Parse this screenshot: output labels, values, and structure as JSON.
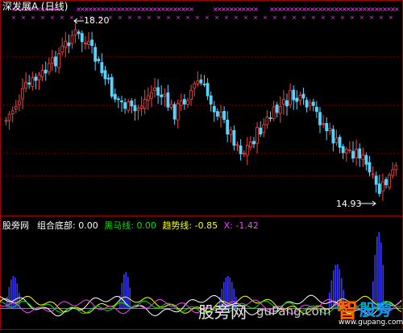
{
  "window": {
    "title": "深发展A (日线)"
  },
  "price_chart": {
    "high_label": "18.20",
    "low_label": "14.93",
    "colors": {
      "up": "#ff4040",
      "down": "#54d4ff",
      "marker": "#ff40ff",
      "frame": "#a00000",
      "text": "#c8c8c8"
    }
  },
  "indicator_legend": {
    "source": "股旁网",
    "items": [
      {
        "label": "组合底部:",
        "value": "0.00",
        "color": "#ffffff"
      },
      {
        "label": "黑马线:",
        "value": "0.00",
        "color": "#00e000"
      },
      {
        "label": "趋势线:",
        "value": "-0.85",
        "color": "#ffff00"
      },
      {
        "label": "X:",
        "value": "-1.42",
        "color": "#ff40ff"
      }
    ]
  },
  "indicator_colors": {
    "bars": "#3838ff",
    "yellow_line": "#ffff00",
    "white_line": "#ffffff",
    "magenta_line": "#ff40ff",
    "green_line": "#00e000",
    "baseline": "#00e000"
  },
  "watermarks": [
    {
      "text": "股旁网",
      "color": "#e8e8e8"
    },
    {
      "text": "guPang.com",
      "color": "#cfcfcf"
    },
    {
      "text": "智",
      "color": "#ff6600"
    },
    {
      "text": "股旁",
      "color": "#00a0e9"
    },
    {
      "text": "www.gupang.com",
      "color": "#ffffff"
    }
  ]
}
